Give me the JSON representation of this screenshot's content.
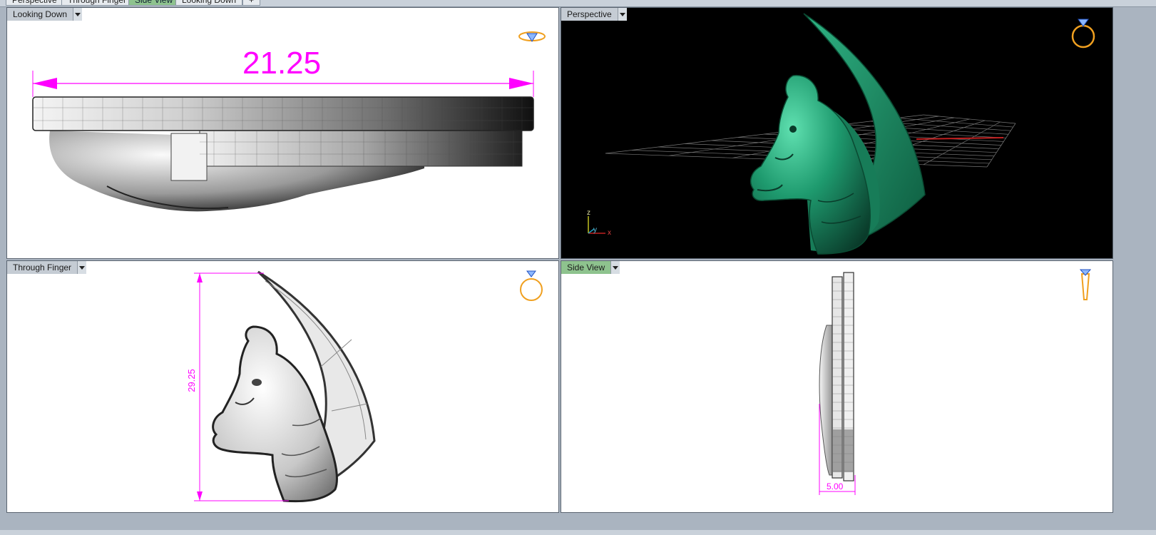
{
  "tabs": [
    {
      "label": "Perspective",
      "active": false
    },
    {
      "label": "Through Finger",
      "active": false
    },
    {
      "label": "Side View",
      "active": true
    },
    {
      "label": "Looking Down",
      "active": false
    },
    {
      "label": "+",
      "active": false
    }
  ],
  "viewports": {
    "top_left": {
      "label": "Looking Down",
      "dimension": "21.25"
    },
    "top_right": {
      "label": "Perspective",
      "axes": {
        "z": "z",
        "y": "y",
        "x": "x"
      }
    },
    "bottom_left": {
      "label": "Through Finger",
      "dimension": "29.25"
    },
    "bottom_right": {
      "label": "Side View",
      "active": true,
      "dimension": "5.00"
    }
  },
  "colors": {
    "dimension": "#ff00ff",
    "model_green": "#1e9a6e",
    "ring_icon": "#f0a020",
    "active_label": "#8ec38e"
  },
  "icons": {
    "orientation_top_left": "ring-top-view-icon",
    "orientation_top_right": "ring-perspective-icon",
    "orientation_bottom_left": "ring-front-icon",
    "orientation_bottom_right": "ring-side-icon"
  }
}
